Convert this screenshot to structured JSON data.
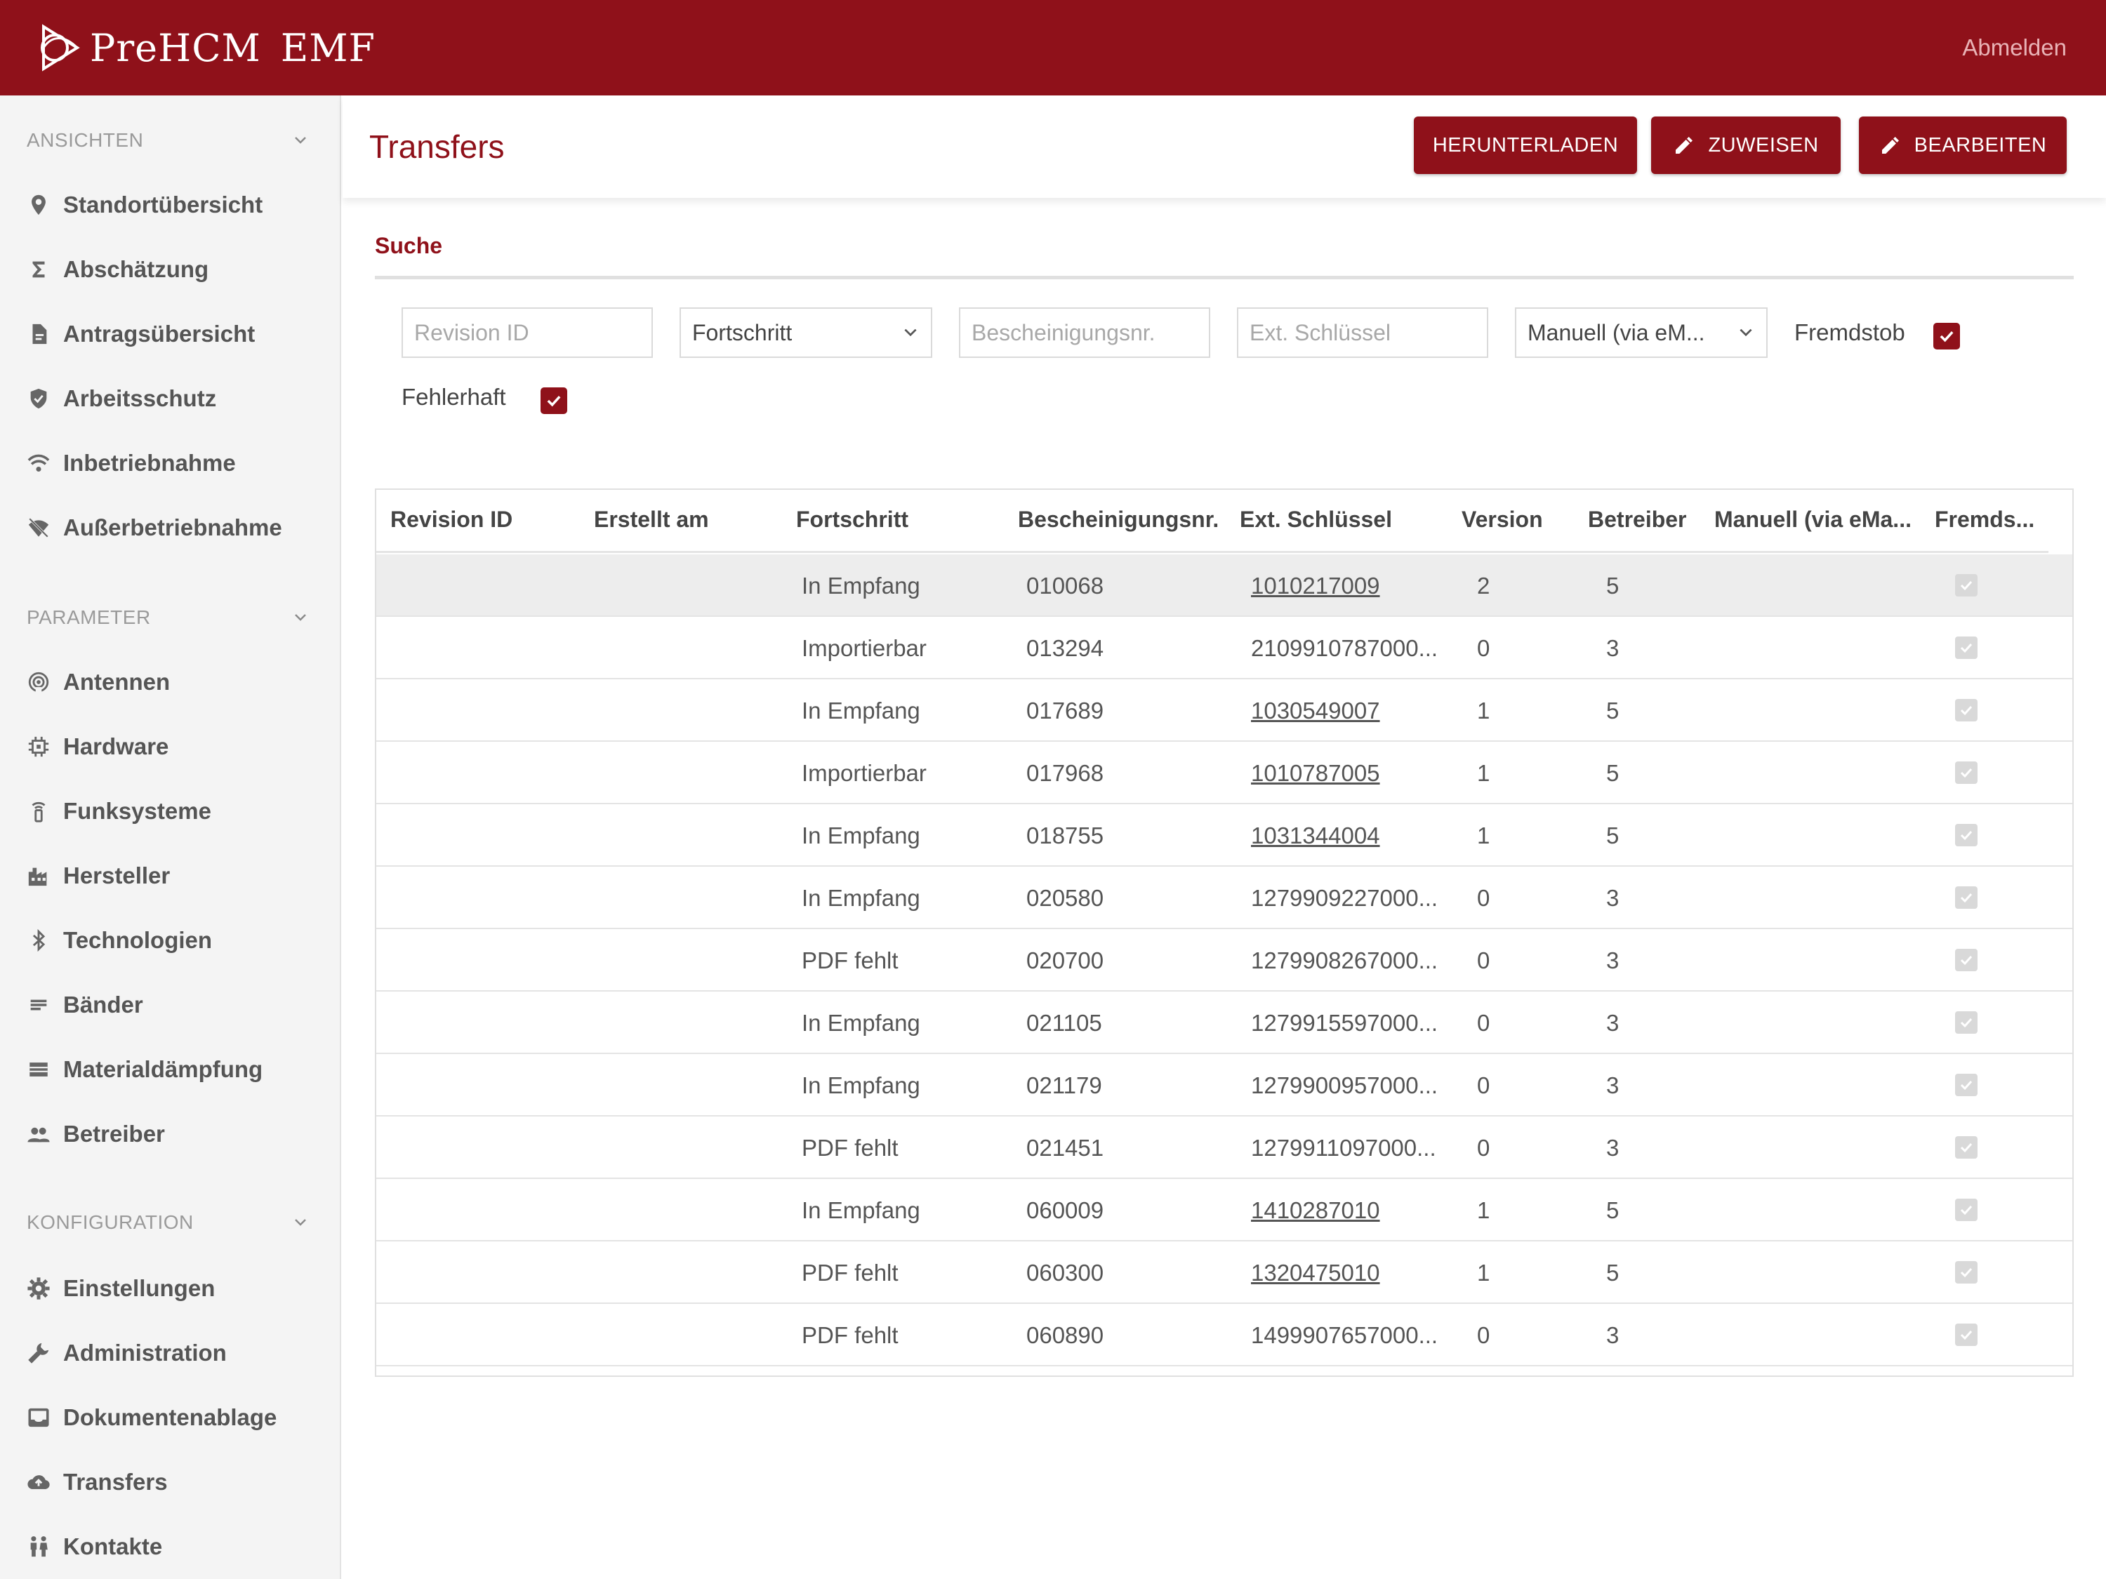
{
  "header": {
    "brand": "PreHCM",
    "brand_suffix": "EMF",
    "logout": "Abmelden"
  },
  "sidebar": {
    "sections": [
      {
        "title": "ANSICHTEN",
        "items": [
          {
            "label": "Standortübersicht",
            "icon": "map-pin-icon"
          },
          {
            "label": "Abschätzung",
            "icon": "sigma-icon"
          },
          {
            "label": "Antragsübersicht",
            "icon": "document-icon"
          },
          {
            "label": "Arbeitsschutz",
            "icon": "shield-icon"
          },
          {
            "label": "Inbetriebnahme",
            "icon": "wifi-icon"
          },
          {
            "label": "Außerbetriebnahme",
            "icon": "wifi-off-icon"
          }
        ]
      },
      {
        "title": "PARAMETER",
        "items": [
          {
            "label": "Antennen",
            "icon": "antenna-icon"
          },
          {
            "label": "Hardware",
            "icon": "chip-icon"
          },
          {
            "label": "Funksysteme",
            "icon": "radio-tower-icon"
          },
          {
            "label": "Hersteller",
            "icon": "factory-icon"
          },
          {
            "label": "Technologien",
            "icon": "bluetooth-icon"
          },
          {
            "label": "Bänder",
            "icon": "lines-icon"
          },
          {
            "label": "Materialdämpfung",
            "icon": "material-icon"
          },
          {
            "label": "Betreiber",
            "icon": "people-icon"
          }
        ]
      },
      {
        "title": "KONFIGURATION",
        "items": [
          {
            "label": "Einstellungen",
            "icon": "gear-icon"
          },
          {
            "label": "Administration",
            "icon": "wrench-icon"
          },
          {
            "label": "Dokumentenablage",
            "icon": "inbox-icon"
          },
          {
            "label": "Transfers",
            "icon": "cloud-upload-icon"
          },
          {
            "label": "Kontakte",
            "icon": "contacts-icon"
          }
        ]
      }
    ]
  },
  "page": {
    "title": "Transfers",
    "buttons": {
      "download": "HERUNTERLADEN",
      "assign": "ZUWEISEN",
      "edit": "BEARBEITEN"
    }
  },
  "search": {
    "title": "Suche",
    "revision_placeholder": "Revision ID",
    "progress_value": "Fortschritt",
    "certificate_placeholder": "Bescheinigungsnr.",
    "extkey_placeholder": "Ext. Schlüssel",
    "manual_value": "Manuell (via eM...",
    "fremdstob_label": "Fremdstob",
    "fehlerhaft_label": "Fehlerhaft",
    "fremdstob_checked": true,
    "fehlerhaft_checked": true
  },
  "table": {
    "columns": [
      "Revision ID",
      "Erstellt am",
      "Fortschritt",
      "Bescheinigungsnr.",
      "Ext. Schlüssel",
      "Version",
      "Betreiber",
      "Manuell (via eMa...",
      "Fremds..."
    ],
    "rows": [
      {
        "revision": "",
        "created": "",
        "progress": "In Empfang",
        "certificate": "010068",
        "extkey": "1010217009",
        "extkey_link": true,
        "version": "2",
        "operator": "5",
        "manual": "",
        "foreign": true
      },
      {
        "revision": "",
        "created": "",
        "progress": "Importierbar",
        "certificate": "013294",
        "extkey": "2109910787000...",
        "extkey_link": false,
        "version": "0",
        "operator": "3",
        "manual": "",
        "foreign": true
      },
      {
        "revision": "",
        "created": "",
        "progress": "In Empfang",
        "certificate": "017689",
        "extkey": "1030549007",
        "extkey_link": true,
        "version": "1",
        "operator": "5",
        "manual": "",
        "foreign": true
      },
      {
        "revision": "",
        "created": "",
        "progress": "Importierbar",
        "certificate": "017968",
        "extkey": "1010787005",
        "extkey_link": true,
        "version": "1",
        "operator": "5",
        "manual": "",
        "foreign": true
      },
      {
        "revision": "",
        "created": "",
        "progress": "In Empfang",
        "certificate": "018755",
        "extkey": "1031344004",
        "extkey_link": true,
        "version": "1",
        "operator": "5",
        "manual": "",
        "foreign": true
      },
      {
        "revision": "",
        "created": "",
        "progress": "In Empfang",
        "certificate": "020580",
        "extkey": "1279909227000...",
        "extkey_link": false,
        "version": "0",
        "operator": "3",
        "manual": "",
        "foreign": true
      },
      {
        "revision": "",
        "created": "",
        "progress": "PDF fehlt",
        "certificate": "020700",
        "extkey": "1279908267000...",
        "extkey_link": false,
        "version": "0",
        "operator": "3",
        "manual": "",
        "foreign": true
      },
      {
        "revision": "",
        "created": "",
        "progress": "In Empfang",
        "certificate": "021105",
        "extkey": "1279915597000...",
        "extkey_link": false,
        "version": "0",
        "operator": "3",
        "manual": "",
        "foreign": true
      },
      {
        "revision": "",
        "created": "",
        "progress": "In Empfang",
        "certificate": "021179",
        "extkey": "1279900957000...",
        "extkey_link": false,
        "version": "0",
        "operator": "3",
        "manual": "",
        "foreign": true
      },
      {
        "revision": "",
        "created": "",
        "progress": "PDF fehlt",
        "certificate": "021451",
        "extkey": "1279911097000...",
        "extkey_link": false,
        "version": "0",
        "operator": "3",
        "manual": "",
        "foreign": true
      },
      {
        "revision": "",
        "created": "",
        "progress": "In Empfang",
        "certificate": "060009",
        "extkey": "1410287010",
        "extkey_link": true,
        "version": "1",
        "operator": "5",
        "manual": "",
        "foreign": true
      },
      {
        "revision": "",
        "created": "",
        "progress": "PDF fehlt",
        "certificate": "060300",
        "extkey": "1320475010",
        "extkey_link": true,
        "version": "1",
        "operator": "5",
        "manual": "",
        "foreign": true
      },
      {
        "revision": "",
        "created": "",
        "progress": "PDF fehlt",
        "certificate": "060890",
        "extkey": "1499907657000...",
        "extkey_link": false,
        "version": "0",
        "operator": "3",
        "manual": "",
        "foreign": true
      }
    ]
  },
  "colors": {
    "brand": "#8f111a",
    "sidebar_bg": "#f4f4f4",
    "row_highlight": "#ededed"
  }
}
